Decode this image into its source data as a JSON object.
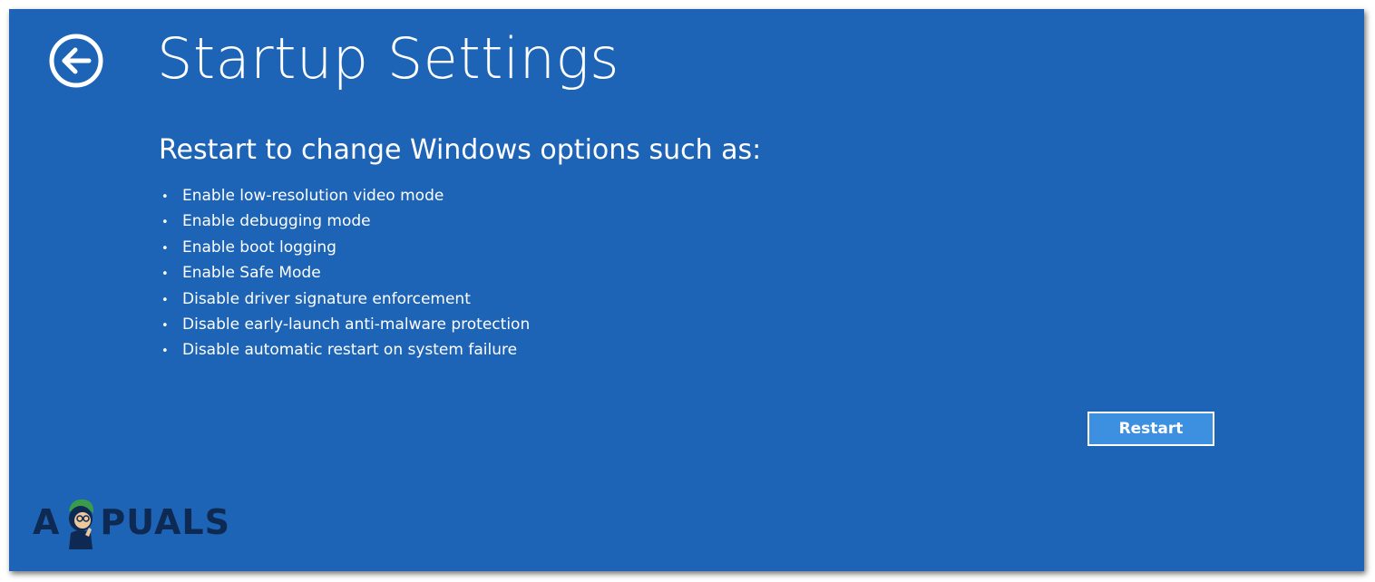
{
  "header": {
    "back_icon": "back-arrow-circle-icon",
    "title": "Startup Settings"
  },
  "main": {
    "subtitle": "Restart to change Windows options such as:",
    "options": [
      "Enable low-resolution video mode",
      "Enable debugging mode",
      "Enable boot logging",
      "Enable Safe Mode",
      "Disable driver signature enforcement",
      "Disable early-launch anti-malware protection",
      "Disable automatic restart on system failure"
    ],
    "restart_label": "Restart"
  },
  "watermark": {
    "text": "APPUALS",
    "prefix": "A",
    "suffix": "PUALS"
  },
  "colors": {
    "background": "#1d64b7",
    "text": "#ffffff",
    "button_fill": "#3d8fe0",
    "watermark": "#0e2a52"
  }
}
